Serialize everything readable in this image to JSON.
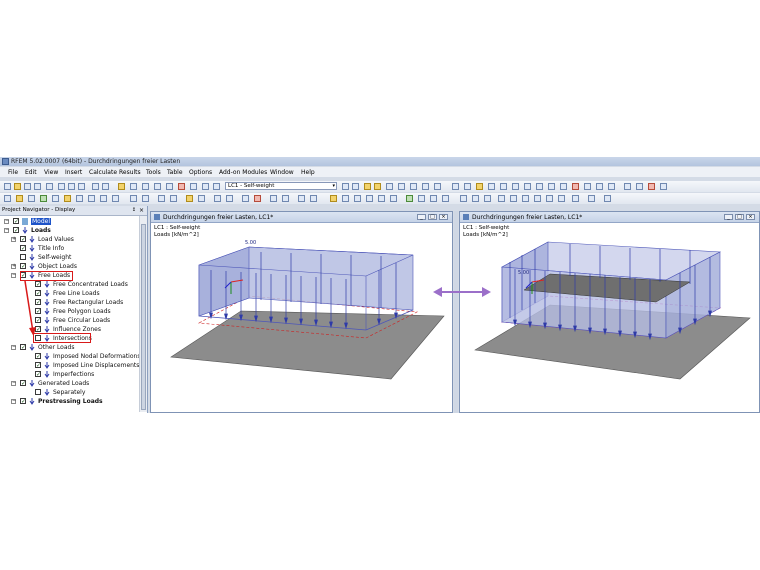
{
  "window_title": "RFEM 5.02.0007 (64bit) - Durchdringungen freier Lasten",
  "menu": [
    "File",
    "Edit",
    "View",
    "Insert",
    "Calculate",
    "Results",
    "Tools",
    "Table",
    "Options",
    "Add-on Modules",
    "Window",
    "Help"
  ],
  "toolbar": {
    "load_case": "LC1 - Self-weight"
  },
  "navigator": {
    "title": "Project Navigator - Display",
    "pin": "↕",
    "close": "×",
    "items": [
      {
        "label": "Model",
        "checked": true,
        "expanded": true,
        "selected": true
      },
      {
        "label": "Loads",
        "checked": true,
        "expanded": true,
        "bold": true
      },
      {
        "label": "Load Values",
        "checked": true,
        "expanded": false
      },
      {
        "label": "Title Info",
        "checked": true
      },
      {
        "label": "Self-weight",
        "checked": false
      },
      {
        "label": "Object Loads",
        "checked": true,
        "expanded": false
      },
      {
        "label": "Free Loads",
        "checked": true,
        "expanded": true
      },
      {
        "label": "Free Concentrated Loads",
        "checked": true
      },
      {
        "label": "Free Line Loads",
        "checked": true
      },
      {
        "label": "Free Rectangular Loads",
        "checked": true
      },
      {
        "label": "Free Polygon Loads",
        "checked": true
      },
      {
        "label": "Free Circular Loads",
        "checked": true
      },
      {
        "label": "Influence Zones",
        "checked": true
      },
      {
        "label": "Intersections",
        "checked": false
      },
      {
        "label": "Other Loads",
        "checked": true,
        "expanded": true
      },
      {
        "label": "Imposed Nodal Deformations",
        "checked": true
      },
      {
        "label": "Imposed Line Displacements",
        "checked": true
      },
      {
        "label": "Imperfections",
        "checked": true
      },
      {
        "label": "Generated Loads",
        "checked": true,
        "expanded": true
      },
      {
        "label": "Separately",
        "checked": false
      },
      {
        "label": "Prestressing Loads",
        "checked": true
      }
    ]
  },
  "views": [
    {
      "title": "Durchdringungen freier Lasten, LC1*",
      "line1": "LC1 : Self-weight",
      "line2": "Loads [kN/m^2]",
      "value_label": "5.00"
    },
    {
      "title": "Durchdringungen freier Lasten, LC1*",
      "line1": "LC1 : Self-weight",
      "line2": "Loads [kN/m^2]",
      "value_label": "5.00"
    }
  ],
  "colors": {
    "load_fill": "#b5bde2",
    "load_arrow": "#2f3ba8",
    "surface": "#8a8a8a",
    "highlight": "#d81a1a",
    "compare_arrow": "#9b6fc9",
    "selection": "#1d53c8"
  }
}
